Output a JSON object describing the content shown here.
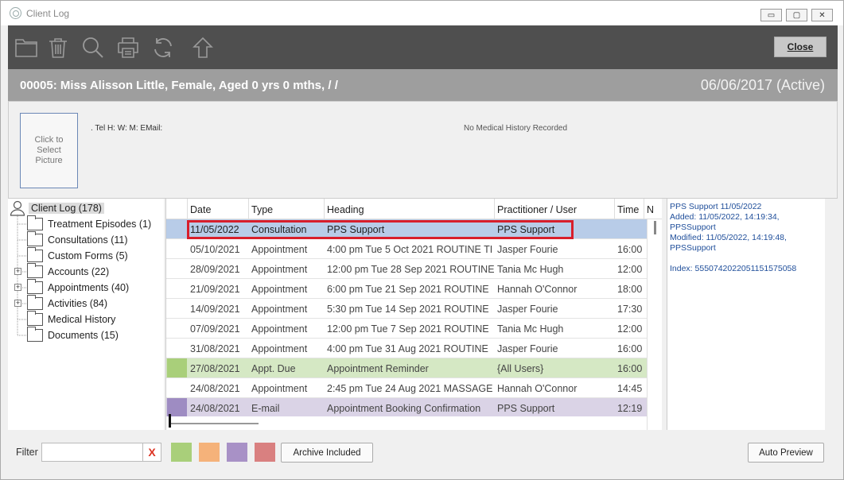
{
  "window": {
    "title": "Client Log",
    "controls": {
      "minimize": "▭",
      "restore": "▢",
      "close": "✕"
    }
  },
  "toolbar": {
    "icons": [
      "folder-icon",
      "trash-icon",
      "search-icon",
      "print-icon",
      "refresh-icon",
      "upload-arrow-icon"
    ],
    "close_label": "Close"
  },
  "patient": {
    "header": "00005: Miss Alisson Little, Female, Aged 0 yrs 0 mths,   / /",
    "status": "06/06/2017 (Active)"
  },
  "info": {
    "picture_label": "Click to Select Picture",
    "contact": ".  Tel H:  W:  M:  EMail:",
    "medical_history": "No Medical History Recorded"
  },
  "tree": {
    "root": "Client Log (178)",
    "items": [
      {
        "label": "Treatment Episodes (1)",
        "expandable": false
      },
      {
        "label": "Consultations (11)",
        "expandable": false
      },
      {
        "label": "Custom Forms (5)",
        "expandable": false
      },
      {
        "label": "Accounts (22)",
        "expandable": true
      },
      {
        "label": "Appointments (40)",
        "expandable": true
      },
      {
        "label": "Activities (84)",
        "expandable": true
      },
      {
        "label": "Medical History",
        "expandable": false
      },
      {
        "label": "Documents (15)",
        "expandable": false
      }
    ]
  },
  "grid": {
    "columns": [
      "Date",
      "Type",
      "Heading",
      "Practitioner / User",
      "Time",
      "N"
    ],
    "rows": [
      {
        "date": "11/05/2022",
        "type": "Consultation",
        "heading": "PPS Support",
        "practitioner": "PPS Support",
        "time": "",
        "style": "selected",
        "color": ""
      },
      {
        "date": "05/10/2021",
        "type": "Appointment",
        "heading": "4:00 pm Tue 5 Oct 2021 ROUTINE TI",
        "practitioner": "Jasper Fourie",
        "time": "16:00",
        "style": "",
        "color": ""
      },
      {
        "date": "28/09/2021",
        "type": "Appointment",
        "heading": "12:00 pm Tue 28 Sep 2021 ROUTINE",
        "practitioner": "Tania Mc Hugh",
        "time": "12:00",
        "style": "",
        "color": ""
      },
      {
        "date": "21/09/2021",
        "type": "Appointment",
        "heading": "6:00 pm Tue 21 Sep 2021 ROUTINE",
        "practitioner": "Hannah O'Connor",
        "time": "18:00",
        "style": "",
        "color": ""
      },
      {
        "date": "14/09/2021",
        "type": "Appointment",
        "heading": "5:30 pm Tue 14 Sep 2021 ROUTINE",
        "practitioner": "Jasper Fourie",
        "time": "17:30",
        "style": "",
        "color": ""
      },
      {
        "date": "07/09/2021",
        "type": "Appointment",
        "heading": "12:00 pm Tue 7 Sep 2021 ROUTINE",
        "practitioner": "Tania Mc Hugh",
        "time": "12:00",
        "style": "",
        "color": ""
      },
      {
        "date": "31/08/2021",
        "type": "Appointment",
        "heading": "4:00 pm Tue 31 Aug 2021 ROUTINE",
        "practitioner": "Jasper Fourie",
        "time": "16:00",
        "style": "",
        "color": ""
      },
      {
        "date": "27/08/2021",
        "type": "Appt. Due",
        "heading": "Appointment Reminder",
        "practitioner": "{All Users}",
        "time": "16:00",
        "style": "row-appt-due",
        "color": "#a9cf7a"
      },
      {
        "date": "24/08/2021",
        "type": "Appointment",
        "heading": "2:45 pm Tue 24 Aug 2021 MASSAGE",
        "practitioner": "Hannah O'Connor",
        "time": "14:45",
        "style": "",
        "color": ""
      },
      {
        "date": "24/08/2021",
        "type": "E-mail",
        "heading": "Appointment Booking Confirmation",
        "practitioner": "PPS Support",
        "time": "12:19",
        "style": "row-email",
        "color": "#9e8cc2"
      }
    ]
  },
  "detail": {
    "lines": [
      "PPS Support 11/05/2022",
      "Added: 11/05/2022, 14:19:34, PPSSupport",
      "Modified: 11/05/2022, 14:19:48, PPSSupport",
      "",
      "Index: 5550742022051151575058"
    ]
  },
  "footer": {
    "filter_label": "Filter",
    "filter_value": "",
    "clear_label": "X",
    "swatches": [
      "#a9cf7a",
      "#f5b27a",
      "#a891c6",
      "#d98080"
    ],
    "archive_label": "Archive Included",
    "auto_preview_label": "Auto Preview"
  }
}
